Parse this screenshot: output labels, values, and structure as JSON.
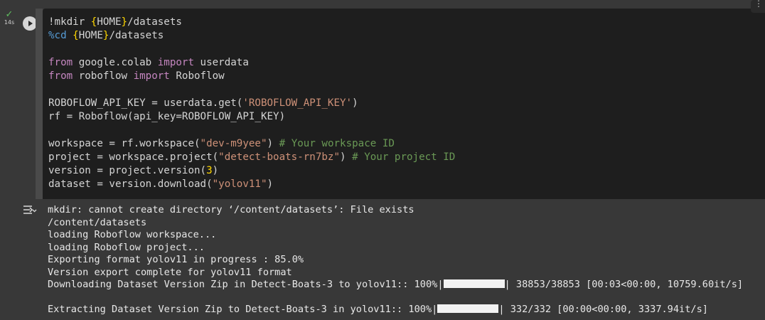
{
  "cell": {
    "status_icon": "check-icon",
    "exec_time": "14s",
    "run_icon": "play-icon",
    "code_lines": [
      [
        {
          "t": "!mkdir ",
          "c": ""
        },
        {
          "t": "{",
          "c": "brace"
        },
        {
          "t": "HOME",
          "c": ""
        },
        {
          "t": "}",
          "c": "brace"
        },
        {
          "t": "/datasets",
          "c": ""
        }
      ],
      [
        {
          "t": "%cd ",
          "c": "magic"
        },
        {
          "t": "{",
          "c": "brace"
        },
        {
          "t": "HOME",
          "c": ""
        },
        {
          "t": "}",
          "c": "brace"
        },
        {
          "t": "/datasets",
          "c": ""
        }
      ],
      [],
      [
        {
          "t": "from",
          "c": "kw"
        },
        {
          "t": " google.colab ",
          "c": ""
        },
        {
          "t": "import",
          "c": "kw"
        },
        {
          "t": " userdata",
          "c": ""
        }
      ],
      [
        {
          "t": "from",
          "c": "kw"
        },
        {
          "t": " roboflow ",
          "c": ""
        },
        {
          "t": "import",
          "c": "kw"
        },
        {
          "t": " Roboflow",
          "c": ""
        }
      ],
      [],
      [
        {
          "t": "ROBOFLOW_API_KEY = userdata.get(",
          "c": ""
        },
        {
          "t": "'ROBOFLOW_API_KEY'",
          "c": "str"
        },
        {
          "t": ")",
          "c": ""
        }
      ],
      [
        {
          "t": "rf = Roboflow(api_key=ROBOFLOW_API_KEY)",
          "c": ""
        }
      ],
      [],
      [
        {
          "t": "workspace = rf.workspace(",
          "c": ""
        },
        {
          "t": "\"dev-m9yee\"",
          "c": "str"
        },
        {
          "t": ") ",
          "c": ""
        },
        {
          "t": "# Your workspace ID",
          "c": "cmt"
        }
      ],
      [
        {
          "t": "project = workspace.project(",
          "c": ""
        },
        {
          "t": "\"detect-boats-rn7bz\"",
          "c": "str"
        },
        {
          "t": ") ",
          "c": ""
        },
        {
          "t": "# Your project ID",
          "c": "cmt"
        }
      ],
      [
        {
          "t": "version = project.version(",
          "c": ""
        },
        {
          "t": "3",
          "c": "brace"
        },
        {
          "t": ")",
          "c": ""
        }
      ],
      [
        {
          "t": "dataset = version.download(",
          "c": ""
        },
        {
          "t": "\"yolov11\"",
          "c": "str"
        },
        {
          "t": ")",
          "c": ""
        }
      ]
    ]
  },
  "output": {
    "icon": "output-toggle-icon",
    "lines": [
      "mkdir: cannot create directory ‘/content/datasets’: File exists",
      "/content/datasets",
      "loading Roboflow workspace...",
      "loading Roboflow project...",
      "Exporting format yolov11 in progress : 85.0%",
      "Version export complete for yolov11 format"
    ],
    "download": {
      "prefix": "Downloading Dataset Version Zip in Detect-Boats-3 to yolov11:: 100%|",
      "progress": 1.0,
      "suffix": "| 38853/38853 [00:03<00:00, 10759.60it/s]"
    },
    "extract": {
      "prefix": "Extracting Dataset Version Zip to Detect-Boats-3 in yolov11:: 100%|",
      "progress": 1.0,
      "suffix": "| 332/332 [00:00<00:00, 3337.94it/s]"
    }
  }
}
